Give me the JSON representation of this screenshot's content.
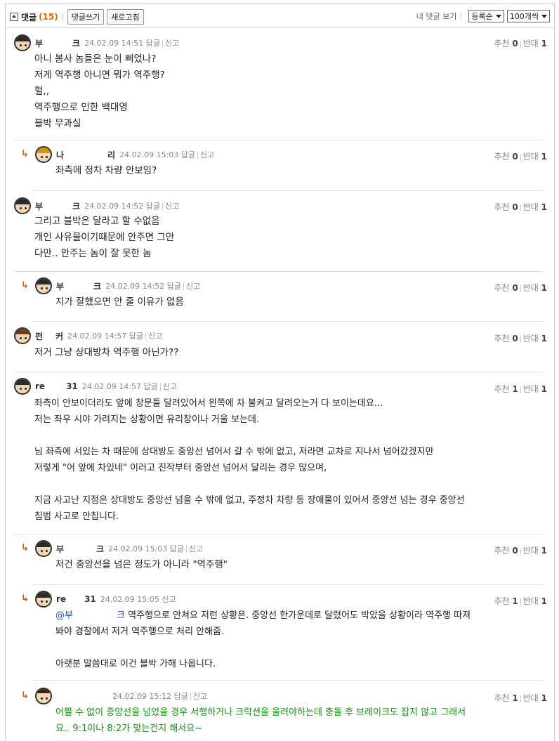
{
  "toolbar": {
    "title": "댓글",
    "count": "(15)",
    "write_label": "댓글쓰기",
    "refresh_label": "새로고침",
    "my_comments_label": "내 댓글 보기",
    "sort_value": "등록순",
    "page_size_value": "100개씩"
  },
  "comments": [
    {
      "nick": "부",
      "nick2": "크",
      "date": "24.02.09 14:51",
      "reply": "답글",
      "report": "신고",
      "rec_label": "추천",
      "rec": "0",
      "opp_label": "반대",
      "opp": "1",
      "lines": [
        "아니 봄사 놈들은 눈이 삐었나?",
        "저게 역주행 아니면 뭐가 역주행?",
        "헐,,",
        "역주행으로 인한 백대영",
        "블박 무과실"
      ]
    },
    {
      "nick": "나",
      "nick2": "리",
      "date": "24.02.09 15:03",
      "reply": "답글",
      "report": "신고",
      "rec_label": "추천",
      "rec": "0",
      "opp_label": "반대",
      "opp": "1",
      "lines": [
        "좌측에 정차 차량 안보임?"
      ]
    },
    {
      "nick": "부",
      "nick2": "크",
      "date": "24.02.09 14:52",
      "reply": "답글",
      "report": "신고",
      "rec_label": "추천",
      "rec": "0",
      "opp_label": "반대",
      "opp": "1",
      "lines": [
        "그리고 블박은 달라고 할 수없음",
        "개인 사유물이기때문에 안주면 그만",
        "다만.. 안주는 놈이 잘 못한 놈"
      ]
    },
    {
      "nick": "부",
      "nick2": "크",
      "date": "24.02.09 14:52",
      "reply": "답글",
      "report": "신고",
      "rec_label": "추천",
      "rec": "0",
      "opp_label": "반대",
      "opp": "1",
      "lines": [
        "지가 잘했으면 안 줄 이유가 없음"
      ]
    },
    {
      "nick": "펀",
      "nick2": "커",
      "date": "24.02.09 14:57",
      "reply": "답글",
      "report": "신고",
      "rec_label": "추천",
      "rec": "0",
      "opp_label": "반대",
      "opp": "1",
      "lines": [
        "저거 그냥 상대방차 역주행 아닌가??"
      ]
    },
    {
      "nick": "re",
      "nick2": "31",
      "date": "24.02.09 14:57",
      "reply": "답글",
      "report": "신고",
      "rec_label": "추천",
      "rec": "1",
      "opp_label": "반대",
      "opp": "1",
      "lines": [
        "좌측이 안보이더라도 앞에 창문들 달려있어서 왼쪽에 차 불켜고 달려오는거 다 보이는데요...",
        "저는 좌우 시야 가려지는 상황이면 유리창이나 거울 보는데.",
        "",
        "님 좌측에 서있는 차 때문에 상대방도 중앙선 넘어서 갈 수 밖에 없고, 저라면 교차로 지나서 넘어갔겠지만",
        "저렇게 \"어 앞에 차있네\" 이러고 진작부터 중앙선 넘어서 달리는 경우 많으며,",
        "",
        "지금 사고난 지점은 상대방도 중앙선 넘을 수 밖에 없고, 주정차 차량 등 장애물이 있어서 중앙선 넘는 경우 중앙선",
        "침범 사고로 안칩니다."
      ]
    },
    {
      "nick": "부",
      "nick2": "크",
      "date": "24.02.09 15:03",
      "reply": "답글",
      "report": "신고",
      "rec_label": "추천",
      "rec": "0",
      "opp_label": "반대",
      "opp": "1",
      "lines": [
        "저건 중앙선을 넘은 정도가 아니라 \"역주행\""
      ]
    },
    {
      "nick": "re",
      "nick2": "31",
      "date": "24.02.09 15:05",
      "reply": "",
      "report": "신고",
      "rec_label": "추천",
      "rec": "1",
      "opp_label": "반대",
      "opp": "1",
      "mention1": "@부",
      "mention2": "크",
      "lines": [
        " 역주행으로 안쳐요 저런 상황은. 중앙선 한가운데로 달렸어도 박았을 상황이라 역주행 따져",
        "봐야 경찰에서 저거 역주행으로 처리 안해줌.",
        "",
        "아랫분 말씀대로 이건 블박 가해 나옵니다."
      ]
    },
    {
      "nick": "",
      "nick2": "",
      "date": "24.02.09 15:12",
      "reply": "답글",
      "report": "신고",
      "rec_label": "추천",
      "rec": "1",
      "opp_label": "반대",
      "opp": "1",
      "lines": [
        "어쩔 수 없이 중앙선을 넘었을 경우 서행하거나 크락션을 울려야하는데 충돌 후 브레이크도 잡지 않고 그래서",
        "요.. 9:1이나 8:2가 맞는건지 해서요~"
      ]
    }
  ]
}
